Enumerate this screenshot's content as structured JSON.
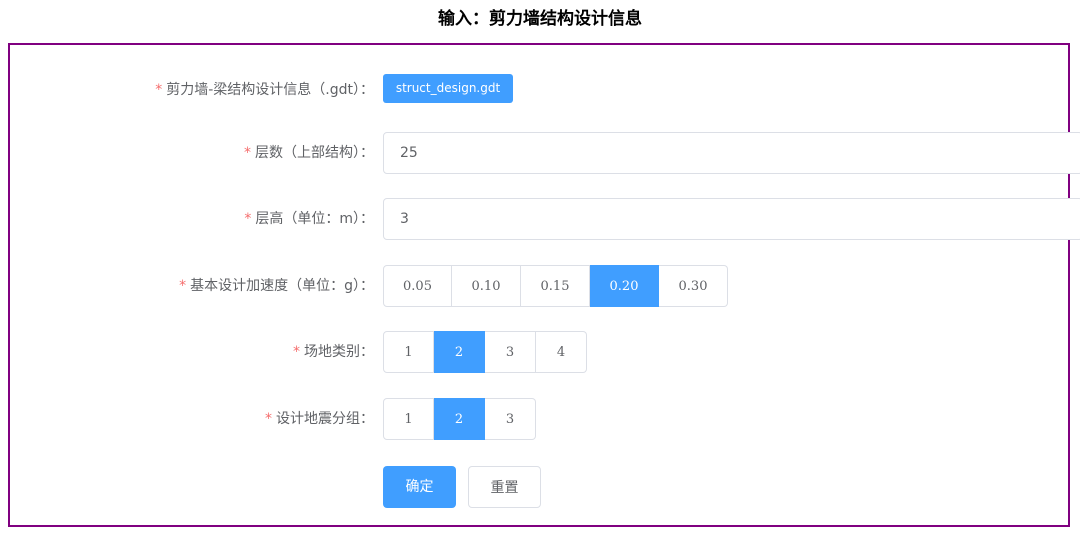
{
  "page_title": "输入：剪力墙结构设计信息",
  "colors": {
    "primary": "#409eff",
    "required": "#f56c6c",
    "border": "#800080"
  },
  "form": {
    "file": {
      "label": "剪力墙-梁结构设计信息（.gdt）：",
      "button": "struct_design.gdt"
    },
    "floors": {
      "label": "层数（上部结构）：",
      "value": "25"
    },
    "height": {
      "label": "层高（单位：m）：",
      "value": "3"
    },
    "acceleration": {
      "label": "基本设计加速度（单位：g）：",
      "options": [
        "0.05",
        "0.10",
        "0.15",
        "0.20",
        "0.30"
      ],
      "selected": "0.20"
    },
    "site": {
      "label": "场地类别：",
      "options": [
        "1",
        "2",
        "3",
        "4"
      ],
      "selected": "2"
    },
    "group": {
      "label": "设计地震分组：",
      "options": [
        "1",
        "2",
        "3"
      ],
      "selected": "2"
    },
    "actions": {
      "confirm": "确定",
      "reset": "重置"
    }
  }
}
